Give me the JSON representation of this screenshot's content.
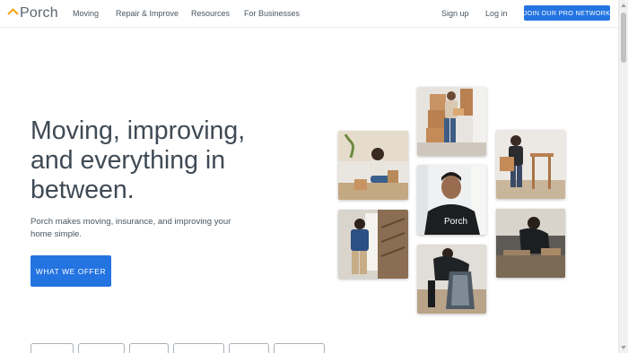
{
  "brand": {
    "name": "Porch",
    "accent": "#f4a71d",
    "primary": "#2374e1"
  },
  "nav": {
    "links": [
      "Moving",
      "Repair & Improve",
      "Resources",
      "For Businesses"
    ],
    "sign_up": "Sign up",
    "log_in": "Log in",
    "join_button": "JOIN OUR PRO NETWORK"
  },
  "hero": {
    "title": "Moving, improving, and everything in between.",
    "subtitle": "Porch makes moving, insurance, and improving your home simple.",
    "cta": "WHAT WE OFFER"
  },
  "photos": {
    "worker_shirt_text": "Porch"
  },
  "icons": [
    "porch-logo-icon",
    "scroll-up-arrow-icon",
    "scroll-down-arrow-icon"
  ]
}
